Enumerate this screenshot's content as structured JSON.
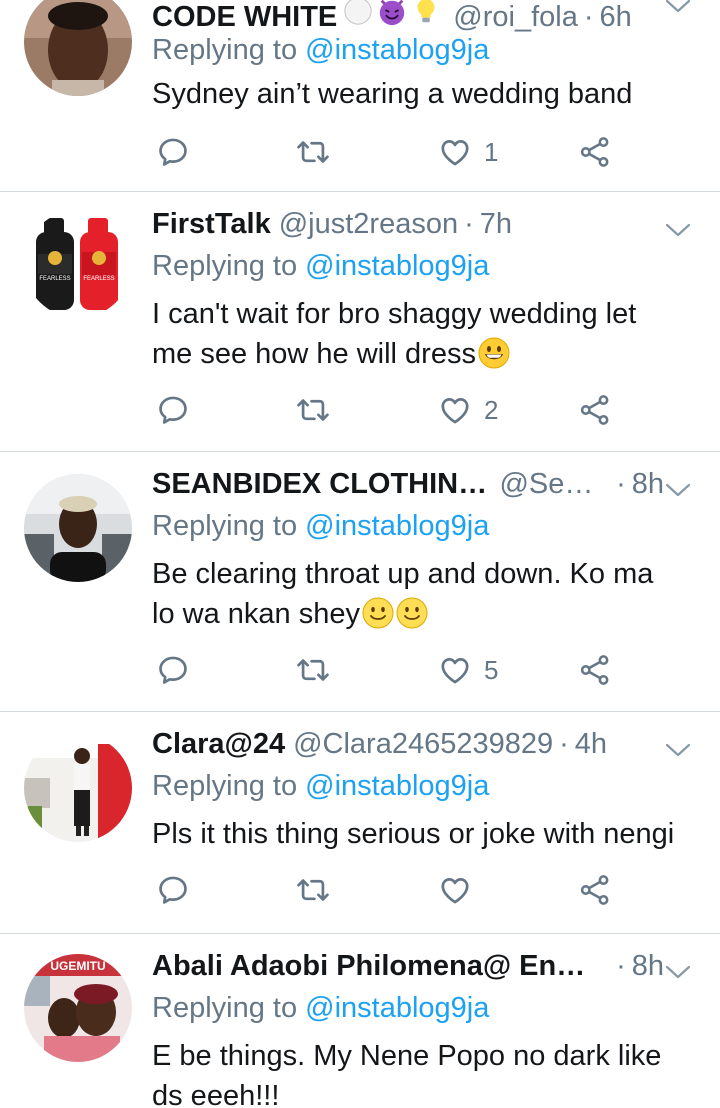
{
  "colors": {
    "text": "#14171a",
    "secondary": "#657786",
    "link": "#1da1f2",
    "divider": "#d4d9dd"
  },
  "tweets": [
    {
      "name": "CODE WHITE",
      "handle": "@roi_fola",
      "time": "6h",
      "replying_label": "Replying to",
      "replying_to": "@instablog9ja",
      "text_lines": [
        "Sydney ain’t wearing a wedding band"
      ],
      "likes": "1"
    },
    {
      "name": "FirstTalk",
      "handle": "@just2reason",
      "time": "7h",
      "replying_label": "Replying to",
      "replying_to": "@instablog9ja",
      "text_lines": [
        "I can't wait for bro shaggy wedding let",
        "me see how he will dress"
      ],
      "likes": "2"
    },
    {
      "name": "SEANBIDEX CLOTHINGS",
      "handle": "@Sea...",
      "time": "8h",
      "replying_label": "Replying to",
      "replying_to": "@instablog9ja",
      "text_lines": [
        "Be clearing throat up and down. Ko ma",
        "lo wa nkan shey"
      ],
      "likes": "5"
    },
    {
      "name": "Clara@24",
      "handle": "@Clara2465239829",
      "time": "4h",
      "replying_label": "Replying to",
      "replying_to": "@instablog9ja",
      "text_lines": [
        "Pls it this thing serious or joke with nengi"
      ],
      "likes": ""
    },
    {
      "name": "Abali Adaobi Philomena@ Enti...",
      "handle": "",
      "time": "8h",
      "replying_label": "Replying to",
      "replying_to": "@instablog9ja",
      "text_lines": [
        "E be things. My Nene Popo no dark like",
        "ds eeeh!!!"
      ],
      "likes": ""
    }
  ],
  "dot": "·",
  "icons": [
    "reply-icon",
    "retweet-icon",
    "like-icon",
    "share-icon",
    "chevron-down-icon",
    "grinning-emoji",
    "slightly-smiling-emoji",
    "smiling-devil-emoji",
    "light-bulb-emoji",
    "white-circle-emoji"
  ],
  "avatar_labels": {
    "t1": {
      "left_bottle": "FEARLESS",
      "right_bottle": "FEARLESS"
    },
    "t4": {
      "banner": "UGEMITU"
    }
  }
}
